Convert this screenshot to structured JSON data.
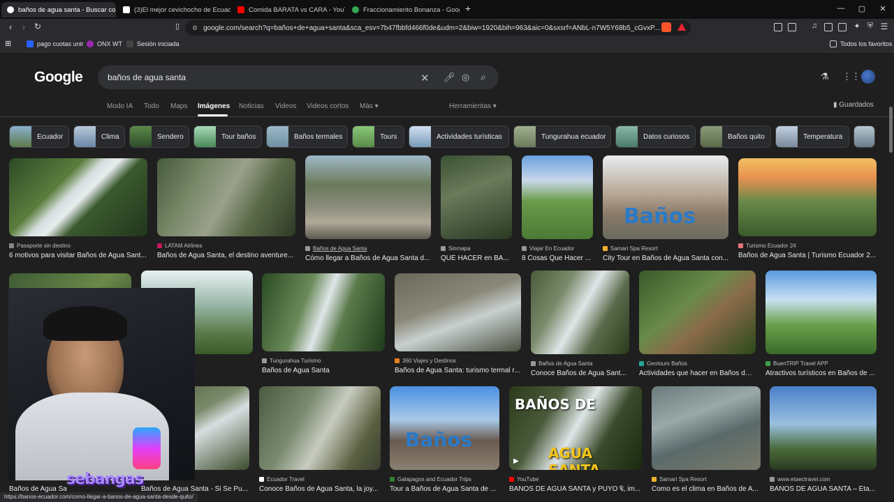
{
  "tabs": [
    {
      "title": "baños de agua santa - Buscar con Google",
      "color": "#ffffff",
      "active": true
    },
    {
      "title": "(3)El mejor cevichocho de Ecuador| m",
      "color": "#ffffff",
      "active": false
    },
    {
      "title": "Comida BARATA vs CARA - YouTube",
      "color": "#ff0000",
      "active": false
    },
    {
      "title": "Fraccionamiento Bonanza - Google M",
      "color": "#34a853",
      "active": false
    }
  ],
  "window_controls": {
    "new_tab": "+",
    "minimize": "—",
    "maximize": "▢",
    "close": "✕"
  },
  "toolbar": {
    "url": "google.com/search?q=baños+de+agua+santa&sca_esv=7b47fbbfd466f0de&udm=2&biw=1920&bih=963&aic=0&sxsrf=ANbL-n7W5Y68b5_cGvxP..."
  },
  "bookmarks": {
    "items": [
      {
        "label": "pago cuotas unir",
        "color": "#2962ff"
      },
      {
        "label": "ONX WT",
        "color": "#9c27b0"
      },
      {
        "label": "Sesión iniciada",
        "color": "#444444"
      }
    ],
    "all_label": "Todos los favoritos"
  },
  "google": {
    "logo": "Google",
    "query": "baños de agua santa",
    "nav_tabs": [
      "Modo IA",
      "Todo",
      "Maps",
      "Imágenes",
      "Noticias",
      "Videos",
      "Videos cortos",
      "Más ▾"
    ],
    "active_tab": "Imágenes",
    "tools": "Herramientas ▾",
    "saved": "Guardados"
  },
  "chips": [
    {
      "label": "Ecuador",
      "color": "#5d7a4a"
    },
    {
      "label": "Clima",
      "color": "#6a88a8"
    },
    {
      "label": "Sendero",
      "color": "#3f6b3a"
    },
    {
      "label": "Tour baños",
      "color": "#4a8a5a"
    },
    {
      "label": "Baños termales",
      "color": "#6f8fa0"
    },
    {
      "label": "Tours",
      "color": "#5a8a4a"
    },
    {
      "label": "Actividades turísticas",
      "color": "#7a9ab8"
    },
    {
      "label": "Tungurahua ecuador",
      "color": "#6a7a5a"
    },
    {
      "label": "Datos curiosos",
      "color": "#4a7a6a"
    },
    {
      "label": "Baños quito",
      "color": "#5a6a4a"
    },
    {
      "label": "Temperatura",
      "color": "#7a8a9a"
    }
  ],
  "results_row1": [
    {
      "source": "Pasaporte sin destino",
      "title": "6 motivos para visitar Baños de Agua Sant...",
      "color": "#3b5a32"
    },
    {
      "source": "LATAM Airlines",
      "title": "Baños de Agua Santa, el destino aventure...",
      "color": "#465a3c"
    },
    {
      "source": "Baños de Agua Santa",
      "title": "Cómo llegar a Baños de Agua Santa d...",
      "color": "#6a6a5a"
    },
    {
      "source": "Sinmapa",
      "title": "QUÉ HACER en BA...",
      "color": "#3a5233"
    },
    {
      "source": "Viajar En Ecuador",
      "title": "8 Cosas Que Hacer ...",
      "color": "#5a8a44"
    },
    {
      "source": "Samari Spa Resort",
      "title": "City Tour en Baños de Agua Santa con...",
      "color": "#8a7a6a"
    },
    {
      "source": "Turismo Ecuador 24",
      "title": "Baños de Agua Santa | Turismo Ecuador 2...",
      "color": "#6a8a4a"
    }
  ],
  "results_row2": [
    {
      "source": "",
      "title": "",
      "color": "#3e5a34"
    },
    {
      "source": "",
      "title": "Agua Santa, la ...",
      "color": "#5a7a6a"
    },
    {
      "source": "Tungurahua Turismo",
      "title": "Baños de Agua Santa",
      "color": "#3a5a30"
    },
    {
      "source": "360 Viajes y Destinos",
      "title": "Baños de Agua Santa: turismo termal r...",
      "color": "#5a6050"
    },
    {
      "source": "Baños de Agua Santa",
      "title": "Conoce Baños de Agua Sant...",
      "color": "#4a5a3a"
    },
    {
      "source": "Geotours Baños",
      "title": "Actividades que hacer en Baños de ...",
      "color": "#3a5a2a"
    },
    {
      "source": "BuenTRIP Travel APP",
      "title": "Atractivos turísticos en Baños de ...",
      "color": "#4a7a4a"
    }
  ],
  "results_row3": [
    {
      "source": "",
      "title": "Baños de Agua Sa",
      "color": "#3a4a30"
    },
    {
      "source": "",
      "title": "Baños de Agua Santa - Si Se Pu...",
      "color": "#4a5a3a"
    },
    {
      "source": "Ecuador Travel",
      "title": "Conoce Baños de Agua Santa, la joy...",
      "color": "#4a5a40"
    },
    {
      "source": "Galapagos and Ecuador Trips",
      "title": "Tour a Baños de Agua Santa de ...",
      "color": "#6a8aa8"
    },
    {
      "source": "YouTube",
      "title": "BAÑOS DE AGUA SANTA y PUYO ₠, im...",
      "color": "#3a4a2a"
    },
    {
      "source": "Samari Spa Resort",
      "title": "Como es el clima en Baños de A...",
      "color": "#5a6a6a"
    },
    {
      "source": "www.etaectravel.com",
      "title": "BAÑOS DE AGUA SANTA – Eta...",
      "color": "#4a6a8a"
    }
  ],
  "overlay_text": {
    "banos_de": "BAÑOS DE",
    "agua_santa": "AGUA SANTA",
    "banos_sign": "Baños"
  },
  "webcam": {
    "handle": "sebangas"
  },
  "status_url": "https://banos-ecuador.com/como-llegar-a-banos-de-agua-santa-desde-quito/"
}
